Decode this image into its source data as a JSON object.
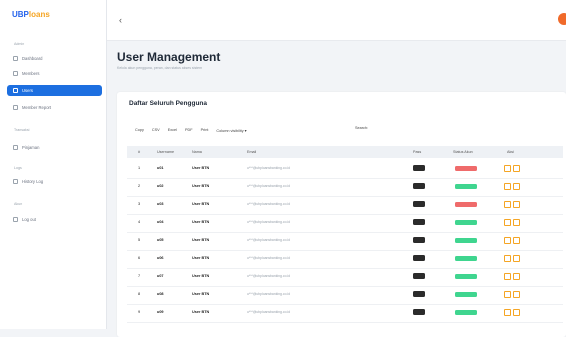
{
  "brand": {
    "part1": "UBP",
    "part2": "loans"
  },
  "sidebar": {
    "sections": [
      {
        "label": "Admin",
        "top": 0
      },
      {
        "label": "Transaksi",
        "top": 0
      },
      {
        "label": "Logs",
        "top": 0
      },
      {
        "label": "Akun",
        "top": 0
      }
    ],
    "items": [
      {
        "label": "Dashboard",
        "active": false
      },
      {
        "label": "Members",
        "active": false
      },
      {
        "label": "Users",
        "active": true
      },
      {
        "label": "Member Report",
        "active": false
      },
      {
        "label": "Pinjaman",
        "active": false
      },
      {
        "label": "History Log",
        "active": false
      },
      {
        "label": "Log out",
        "active": false
      }
    ]
  },
  "topbar": {
    "menu_icon": "menu-icon"
  },
  "page": {
    "title": "User Management",
    "subtitle": "Kelola akun pengguna, peran, dan status akses sistem"
  },
  "table": {
    "title": "Daftar Seluruh Pengguna",
    "tools": [
      "Copy",
      "CSV",
      "Excel",
      "PDF",
      "Print",
      "Column visibility"
    ],
    "search_label": "Search:",
    "columns": [
      "#",
      "Username",
      "Nama",
      "Email",
      "Pass",
      "Status Akun",
      "Aksi"
    ],
    "rows": [
      {
        "no": "1",
        "user": "u01",
        "name": "User BTN",
        "email": "u***@ubploansbanking.co.id",
        "status": "inactive"
      },
      {
        "no": "2",
        "user": "u02",
        "name": "User BTN",
        "email": "u***@ubploansbanking.co.id",
        "status": "active"
      },
      {
        "no": "3",
        "user": "u03",
        "name": "User BTN",
        "email": "u***@ubploansbanking.co.id",
        "status": "inactive"
      },
      {
        "no": "4",
        "user": "u04",
        "name": "User BTN",
        "email": "u***@ubploansbanking.co.id",
        "status": "active"
      },
      {
        "no": "5",
        "user": "u05",
        "name": "User BTN",
        "email": "u***@ubploansbanking.co.id",
        "status": "active"
      },
      {
        "no": "6",
        "user": "u06",
        "name": "User BTN",
        "email": "u***@ubploansbanking.co.id",
        "status": "active"
      },
      {
        "no": "7",
        "user": "u07",
        "name": "User BTN",
        "email": "u***@ubploansbanking.co.id",
        "status": "active"
      },
      {
        "no": "8",
        "user": "u08",
        "name": "User BTN",
        "email": "u***@ubploansbanking.co.id",
        "status": "active"
      },
      {
        "no": "9",
        "user": "u09",
        "name": "User BTN",
        "email": "u***@ubploansbanking.co.id",
        "status": "active"
      }
    ]
  },
  "colors": {
    "primary": "#1d6fe0",
    "active_badge": "#3fd58f",
    "inactive_badge": "#ef6b6b",
    "action_border": "#f5a524",
    "avatar": "#f06a2a"
  }
}
